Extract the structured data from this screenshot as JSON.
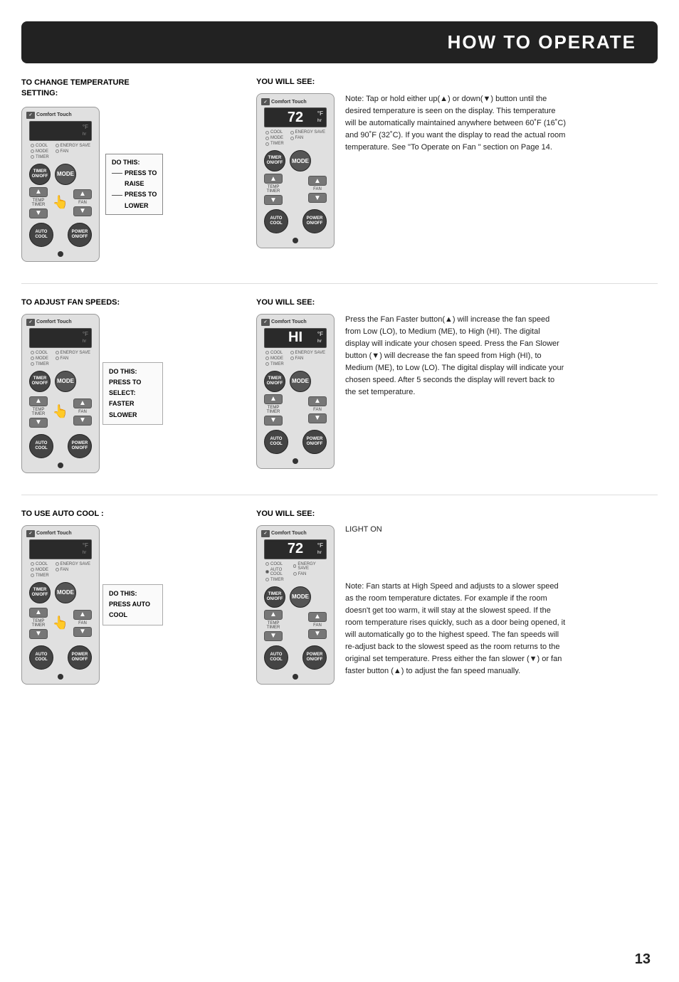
{
  "page": {
    "title": "HOW TO OPERATE",
    "page_number": "13"
  },
  "sections": [
    {
      "id": "change-temp",
      "left_heading": "TO CHANGE TEMPERATURE SETTING:",
      "right_heading": "YOU WILL SEE:",
      "do_this_label": "DO THIS:",
      "do_this_lines": [
        "PRESS TO",
        "RAISE",
        "PRESS TO",
        "LOWER"
      ],
      "note": "Note:  Tap or hold either up(▲) or down(▼) button until the desired temperature is seen on the display. This temperature will be automatically maintained anywhere between 60˚F (16˚C) and 90˚F (32˚C). If you want the display to read the actual room temperature. See \"To Operate on Fan \" section on Page 14.",
      "left_display": "",
      "right_display": "72"
    },
    {
      "id": "fan-speeds",
      "left_heading": "TO ADJUST FAN SPEEDS:",
      "right_heading": "YOU WILL SEE:",
      "do_this_label": "DO THIS:",
      "do_this_lines": [
        "PRESS TO",
        "SELECT:",
        "FASTER",
        "SLOWER"
      ],
      "note": "Press the Fan Faster button(▲) will increase the fan speed from Low (LO), to Medium (ME), to High (HI). The digital display will indicate your chosen speed. Press the Fan Slower button (▼) will decrease the fan speed from High (HI), to Medium (ME), to Low (LO). The digital display will indicate your chosen speed.  After 5 seconds the display will revert back to the set temperature.",
      "left_display": "",
      "right_display": "HI"
    },
    {
      "id": "auto-cool",
      "left_heading": "TO USE AUTO COOL :",
      "right_heading": "YOU WILL SEE:",
      "do_this_label": "DO THIS:",
      "do_this_lines": [
        "PRESS AUTO",
        "COOL"
      ],
      "light_on_label": "LIGHT ON",
      "note": "Note:  Fan starts at High Speed and adjusts to a slower speed as the room temperature dictates. For example if the room doesn't get too warm, it will stay at the slowest speed. If the room temperature rises quickly, such as a door being opened, it will automatically go to  the  highest speed. The fan speeds will re-adjust back to the slowest speed as the room returns to the original set temperature. Press either the fan slower (▼) or fan faster button (▲) to adjust the fan speed manually.",
      "left_display": "",
      "right_display": "72",
      "right_light_dot": true
    }
  ]
}
